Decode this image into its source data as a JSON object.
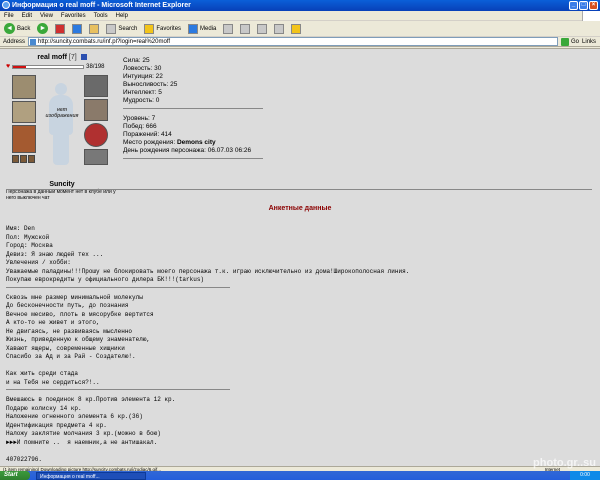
{
  "window": {
    "title": "Информация о real moff - Microsoft Internet Explorer",
    "buttons": {
      "minimize": "_",
      "maximize": "□",
      "close": "×"
    }
  },
  "menu": [
    "File",
    "Edit",
    "View",
    "Favorites",
    "Tools",
    "Help"
  ],
  "toolbar": {
    "back": "Back",
    "search": "Search",
    "favorites": "Favorites",
    "media": "Media"
  },
  "address": {
    "label": "Address",
    "url": "http://suncity.combats.ru/inf.pl?login=real%20moff",
    "go": "Go",
    "links": "Links"
  },
  "character": {
    "name": "real moff",
    "level": "[7]",
    "hp_text": "38/198",
    "hp_fraction": 0.19,
    "no_image": "нет изображения",
    "city": "Suncity",
    "chat_note": "Персонажа в данный момент нет в клубе или у него выключен чат"
  },
  "stats": {
    "strength": "Сила: 25",
    "agility": "Ловкость: 30",
    "intuition": "Интуиция: 22",
    "endurance": "Выносливость: 25",
    "intellect": "Интеллект: 5",
    "wisdom": "Мудрость: 0",
    "level": "Уровень: 7",
    "wins": "Побед: 666",
    "losses": "Поражений: 414",
    "birthplace_label": "Место рождения: ",
    "birthplace_value": "Demons city",
    "birthday": "День рождения персонажа: 06.07.03 06:26"
  },
  "profile": {
    "title": "Анкетные данные",
    "name": "Имя: Den",
    "sex": "Пол: Мужской",
    "city": "Город: Москва",
    "motto": "Девиз: Я знаю людей тех ...",
    "hobbies_label": "Увлечения / хобби:",
    "text_block_1": [
      "Уважаемые паладины!!!Прошу не блокировать моего персонажа т.к. играю исключительно из дома!Широкополосная линия.",
      "Покупаю еврокредиты у официального дилера БК!!!(tarkus)"
    ],
    "poem": [
      "Сквозь мне размер минимальной молекулы",
      "До бесконечности путь, до познания",
      "Вечное месиво, плоть в мясорубке вертится",
      "А кто-то не живет и этого,",
      "Не двигаясь, не развиваясь мысленно",
      "Жизнь, приведенную к общему знаменателю,",
      "Хавают ящеры, современные хищники",
      "Спасибо за Ад и за Рай - Создателю!."
    ],
    "question": [
      "Как жить среди стада",
      "и на Тебя не сердиться?!.."
    ],
    "services": [
      "Вмешаюсь в поединок 8 кр.Против элемента 12 кр.",
      "Подарю колиску 14 кр.",
      "Наложение огненного элемента 6 кр.(36)",
      "Идентификация предмета 4 кр.",
      "Наложу заклятие молчания 3 кр.(можно в бою)",
      "►►►И помните ..  я наемник,а не антишакал."
    ],
    "icq": "407022796."
  },
  "statusbar": {
    "text": "(1 item remaining) Downloading picture http://suncity.combats.ru/i/zodiac/6.gif...",
    "zone": "Internet"
  },
  "taskbar": {
    "start": "Start",
    "item": "Информация о real moff...",
    "tray": "0:00"
  },
  "watermark": "photo.gr..su"
}
